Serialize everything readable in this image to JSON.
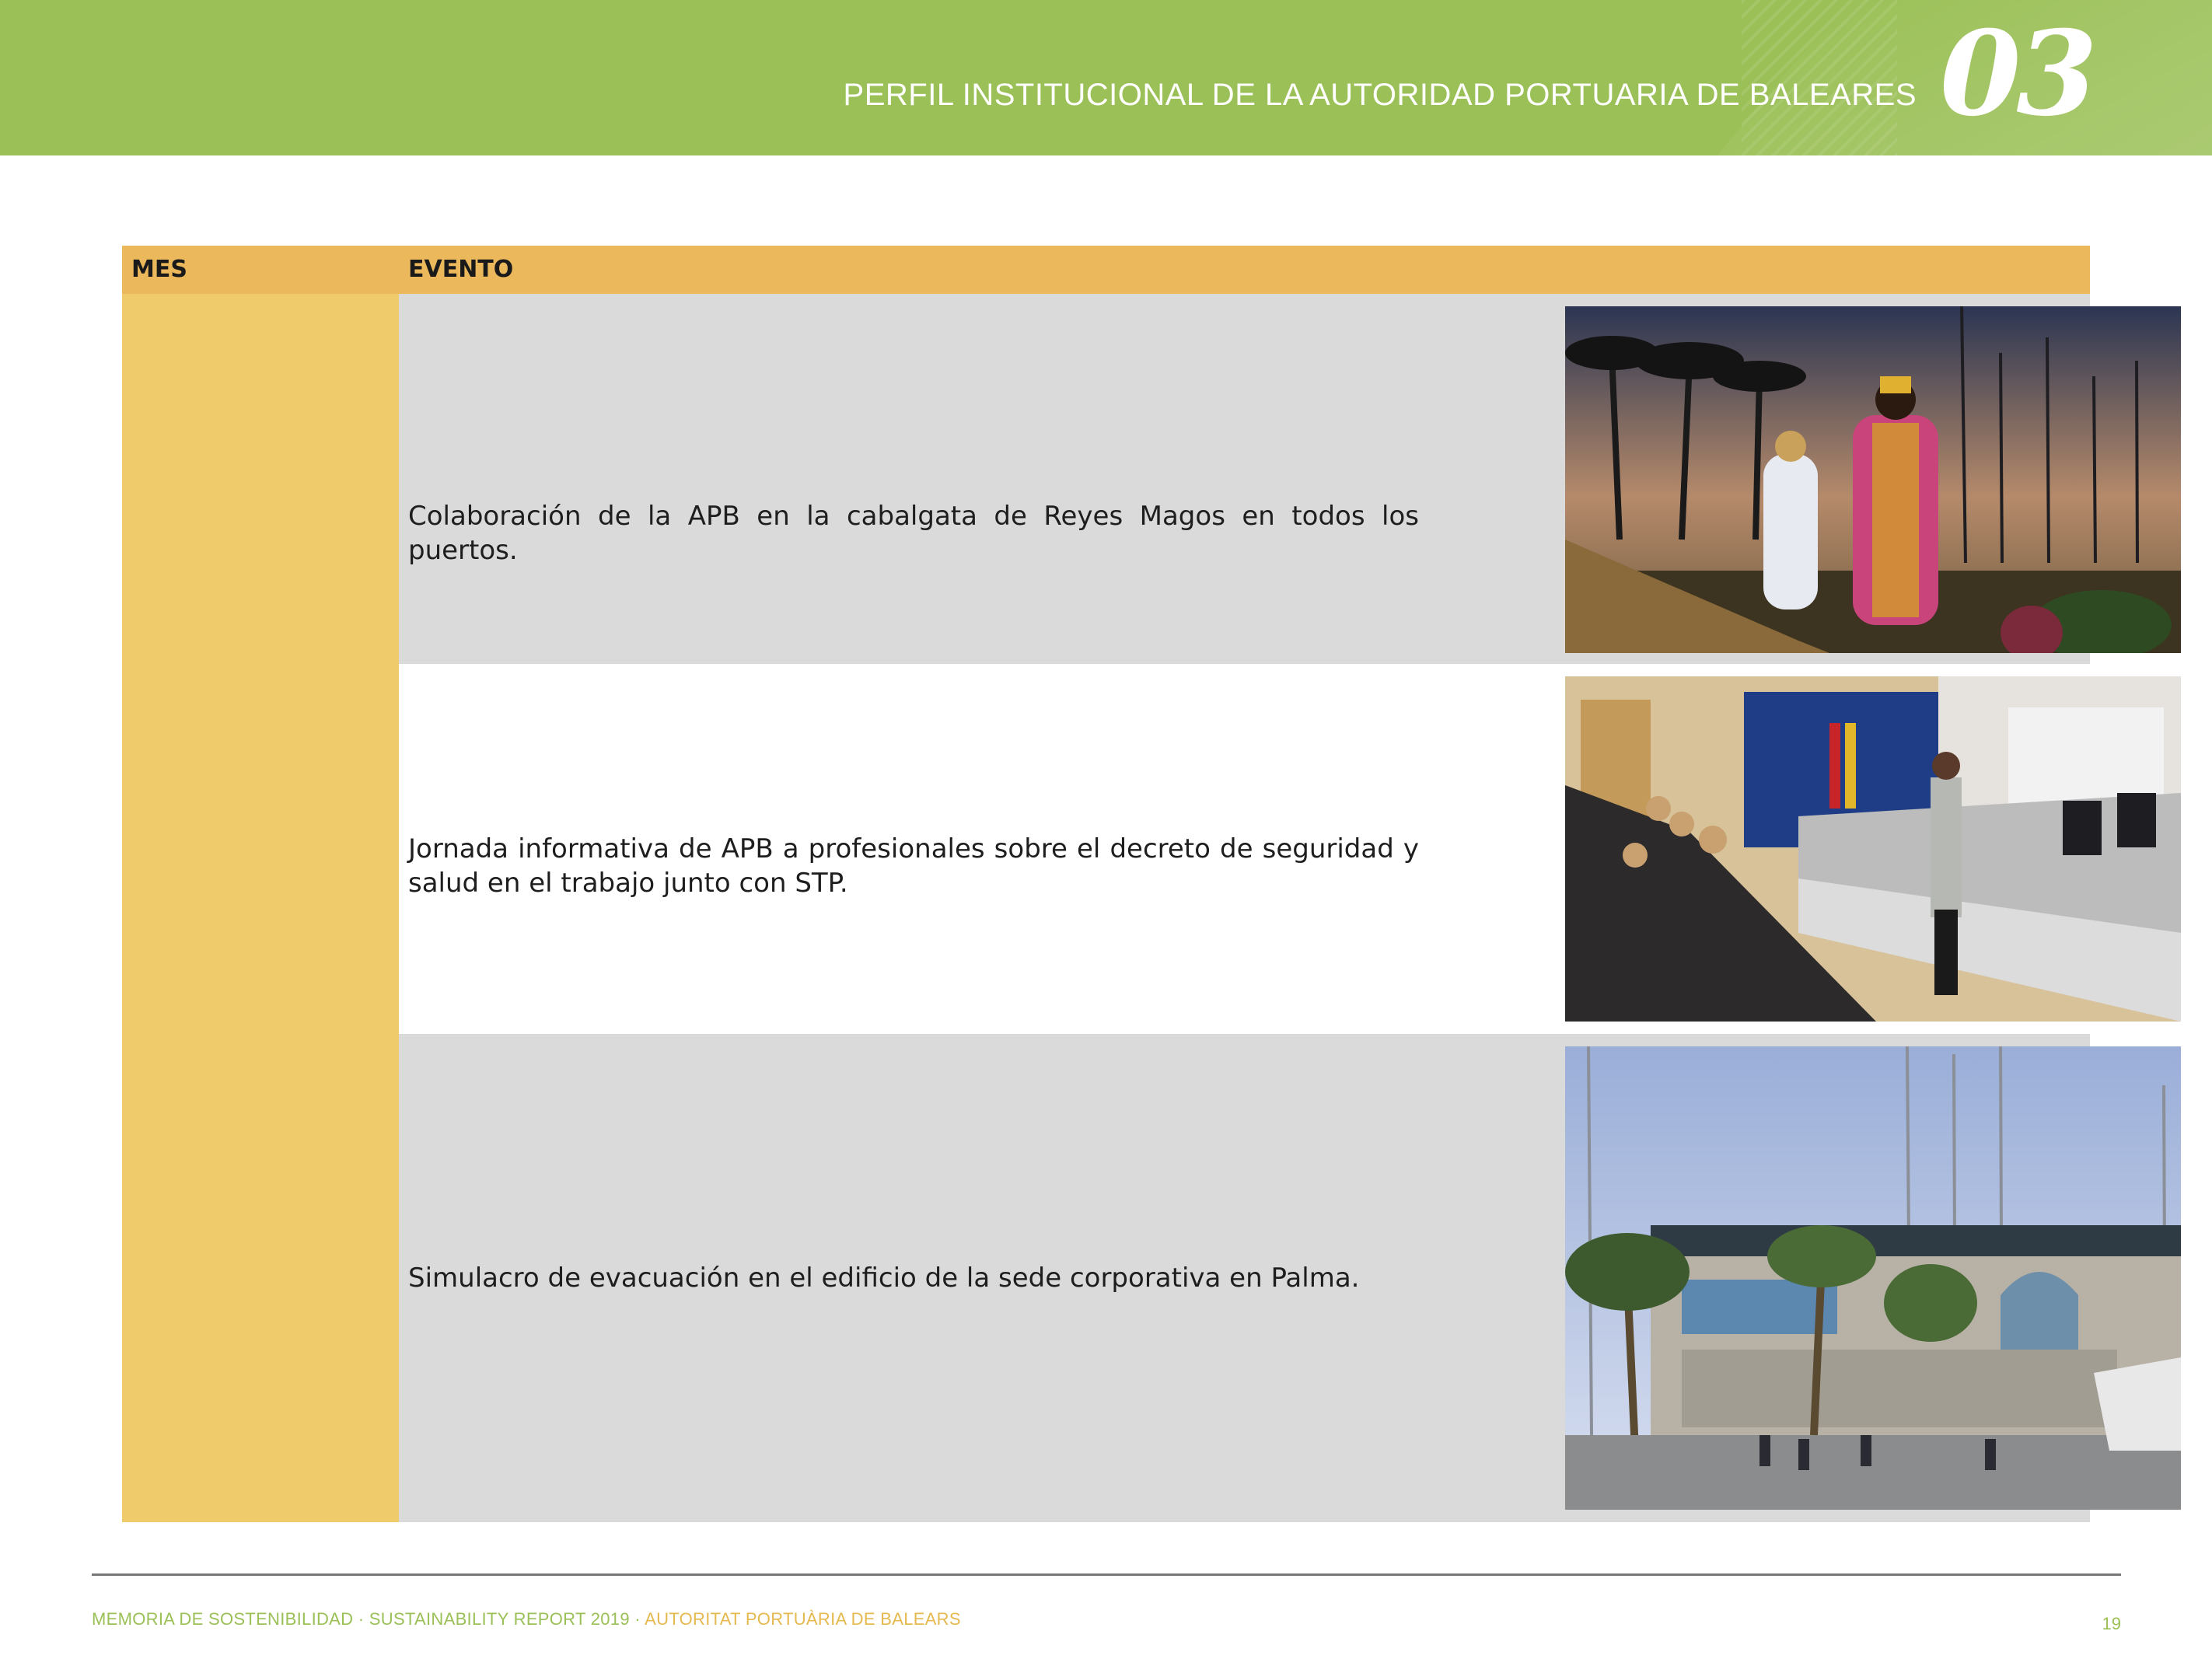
{
  "header": {
    "title": "PERFIL INSTITUCIONAL DE LA AUTORIDAD PORTUARIA DE BALEARES",
    "chapter_number": "03",
    "band_color": "#9bc057"
  },
  "table": {
    "columns": [
      "MES",
      "EVENTO"
    ],
    "header_color": "#ebb95b",
    "month_cell_color": "#efcb6c",
    "month_value": "",
    "rows": [
      {
        "text": "Colaboración de la APB en la cabalgata de Reyes Magos en todos los puertos.",
        "photo": "three-kings-parade-photo"
      },
      {
        "text": "Jornada informativa de APB a profesionales sobre el decreto de seguridad y salud en el trabajo junto con STP.",
        "photo": "information-session-photo"
      },
      {
        "text": "Simulacro de evacuación en el edificio de la sede corporativa en Palma.",
        "photo": "headquarters-evacuation-photo"
      }
    ]
  },
  "footer": {
    "text_main": "MEMORIA DE SOSTENIBILIDAD · SUSTAINABILITY REPORT 2019 · ",
    "text_accent": "AUTORITAT PORTUÀRIA DE BALEARS",
    "page_number": "19"
  }
}
